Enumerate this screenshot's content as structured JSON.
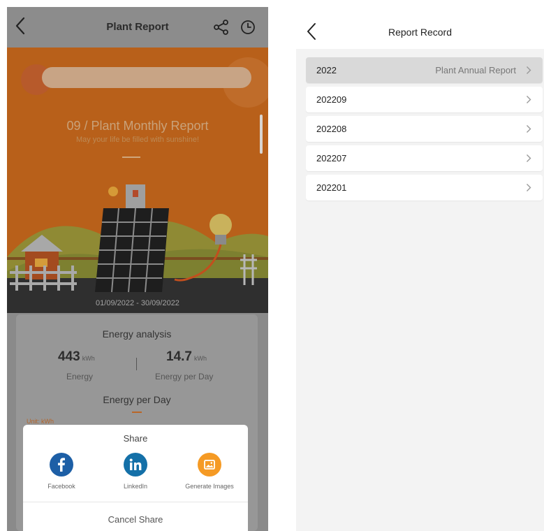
{
  "left_screen": {
    "header": {
      "title": "Plant Report"
    },
    "report": {
      "title": "09 / Plant Monthly Report",
      "subtitle": "May your life be filled with sunshine!",
      "date_range": "01/09/2022 - 30/09/2022"
    },
    "energy_card": {
      "title": "Energy analysis",
      "energy_value": "443",
      "energy_unit": "kWh",
      "energy_label": "Energy",
      "per_day_value": "14.7",
      "per_day_unit": "kWh",
      "per_day_label": "Energy per Day",
      "section2_title": "Energy per Day",
      "unit_note": "Unit: kWh"
    },
    "share_sheet": {
      "title": "Share",
      "options": [
        {
          "label": "Facebook",
          "icon": "facebook-icon",
          "color": "#1d5fa6"
        },
        {
          "label": "LinkedIn",
          "icon": "linkedin-icon",
          "color": "#1470a8"
        },
        {
          "label": "Generate Images",
          "icon": "image-icon",
          "color": "#f59a24"
        }
      ],
      "cancel_label": "Cancel Share"
    }
  },
  "right_screen": {
    "header": {
      "title": "Report Record"
    },
    "records": [
      {
        "label": "2022",
        "extra": "Plant Annual Report",
        "active": true
      },
      {
        "label": "202209",
        "extra": "",
        "active": false
      },
      {
        "label": "202208",
        "extra": "",
        "active": false
      },
      {
        "label": "202207",
        "extra": "",
        "active": false
      },
      {
        "label": "202201",
        "extra": "",
        "active": false
      }
    ]
  }
}
